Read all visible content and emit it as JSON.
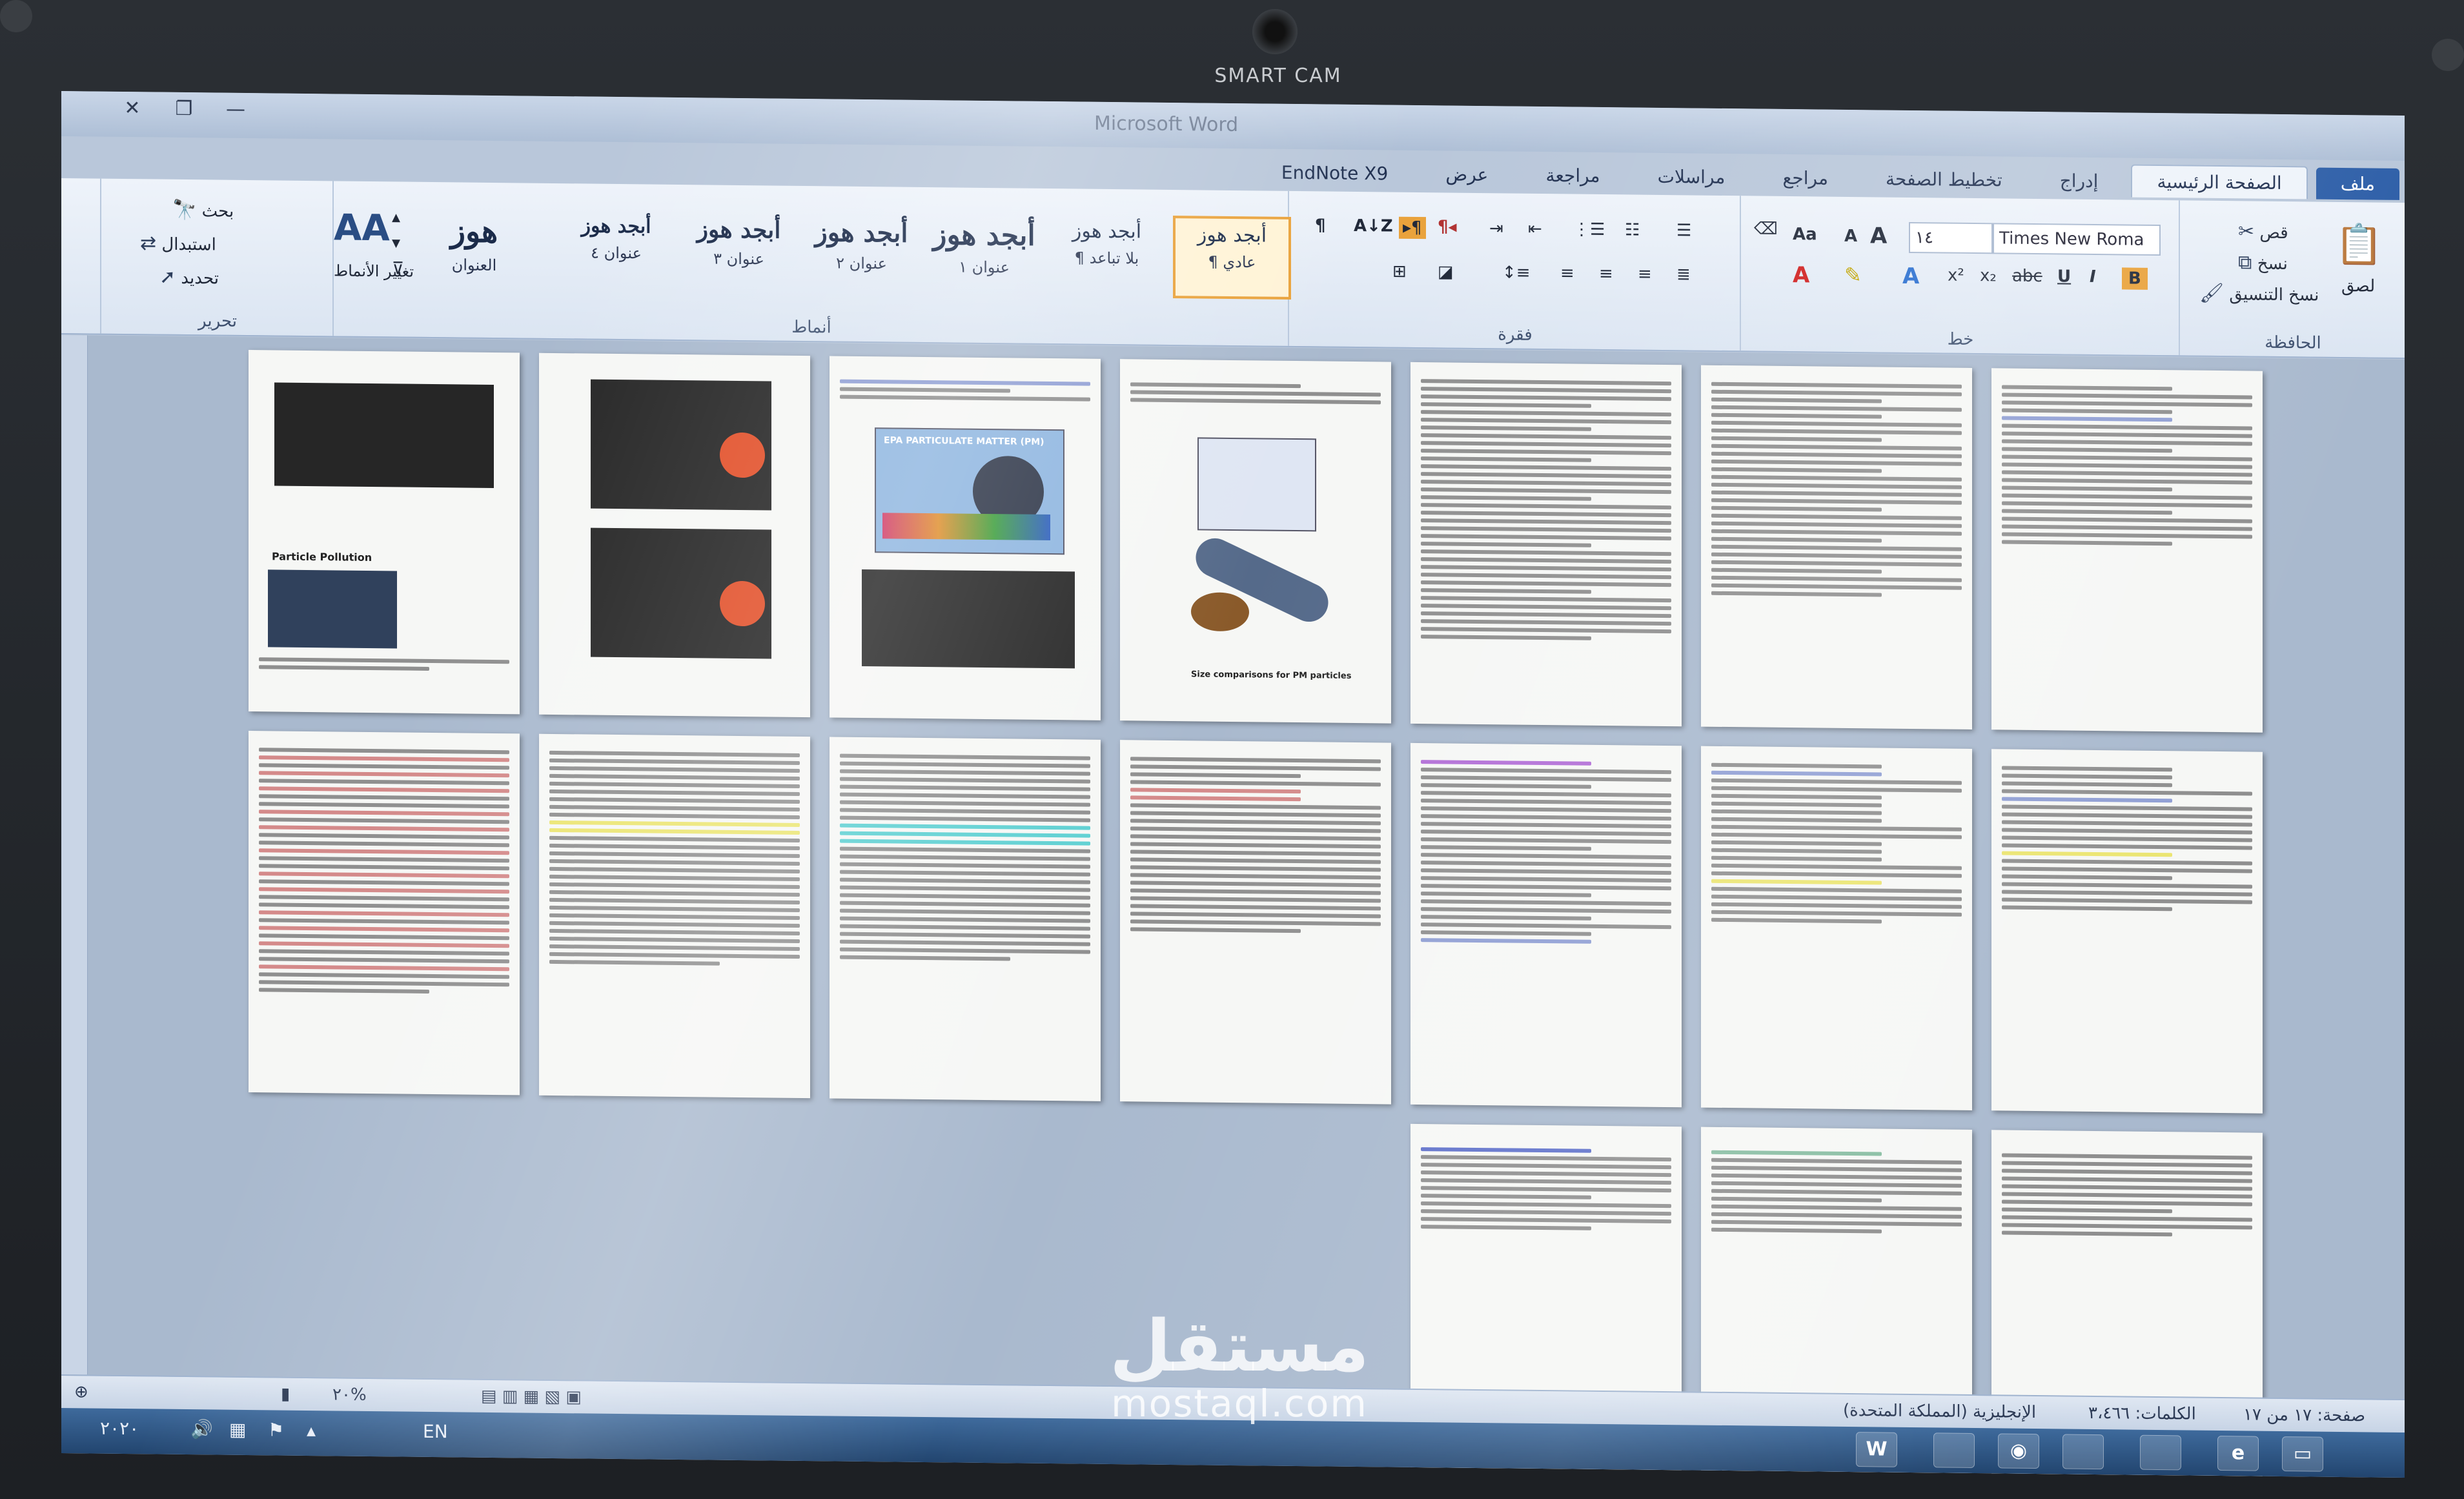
{
  "bezel": {
    "camera_label": "SMART CAM"
  },
  "window": {
    "title": "Microsoft Word",
    "controls": [
      "✕",
      "❐",
      "—"
    ]
  },
  "tabs": [
    {
      "label": "ملف",
      "state": "file"
    },
    {
      "label": "الصفحة الرئيسية",
      "state": "active"
    },
    {
      "label": "إدراج",
      "state": ""
    },
    {
      "label": "تخطيط الصفحة",
      "state": ""
    },
    {
      "label": "مراجع",
      "state": ""
    },
    {
      "label": "مراسلات",
      "state": ""
    },
    {
      "label": "مراجعة",
      "state": ""
    },
    {
      "label": "عرض",
      "state": ""
    },
    {
      "label": "EndNote X9",
      "state": ""
    }
  ],
  "ribbon": {
    "clipboard": {
      "label": "الحافظة",
      "paste": "لصق",
      "cut": "قص",
      "copy": "نسخ",
      "format_painter": "نسخ التنسيق"
    },
    "font": {
      "label": "خط",
      "font_name": "Times New Roma",
      "font_size": "١٤",
      "grow": "A",
      "shrink": "A",
      "case": "Aa"
    },
    "paragraph": {
      "label": "فقرة"
    },
    "styles": {
      "label": "أنماط",
      "items": [
        {
          "sample": "أبجد هوز",
          "name": "¶ عادي"
        },
        {
          "sample": "أبجد هوز",
          "name": "¶ بلا تباعد"
        },
        {
          "sample": "أبجد هوز",
          "name": "عنوان ١"
        },
        {
          "sample": "أبجد هوز",
          "name": "عنوان ٢"
        },
        {
          "sample": "أبجد هوز",
          "name": "عنوان ٣"
        },
        {
          "sample": "أبجد هوز",
          "name": "عنوان ٤"
        },
        {
          "sample": "هوز",
          "name": "العنوان"
        }
      ],
      "change_styles": "تغيير الأنماط"
    },
    "editing": {
      "label": "تحرير",
      "find": "بحث",
      "replace": "استبدال",
      "select": "تحديد"
    }
  },
  "document": {
    "page1_heading": "Particle Pollution",
    "page3_title": "EPA PARTICULATE MATTER (PM)",
    "page4_caption": "Size comparisons for PM particles"
  },
  "statusbar": {
    "page": "صفحة: ١٧ من ١٧",
    "words": "الكلمات: ٣،٤٦٦",
    "language": "الإنجليزية (المملكة المتحدة)",
    "zoom": "٢٠%"
  },
  "taskbar": {
    "lang": "EN",
    "date": "٢٠٢٠",
    "word_icon": "W"
  },
  "watermark": {
    "arabic": "مستقل",
    "latin": "mostaql.com"
  }
}
